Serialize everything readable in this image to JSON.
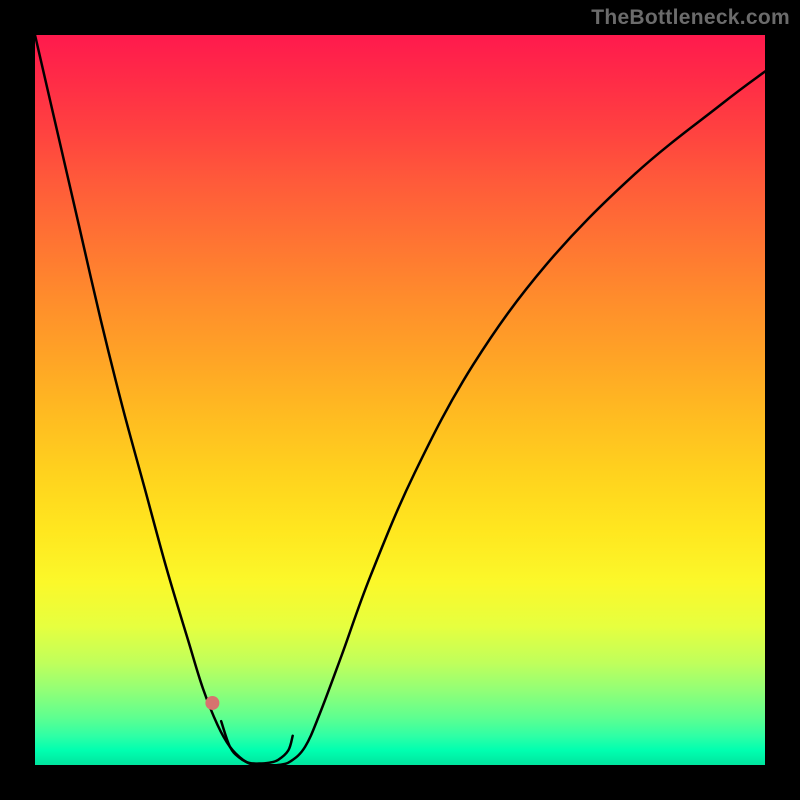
{
  "watermark": "TheBottleneck.com",
  "chart_data": {
    "type": "line",
    "title": "",
    "xlabel": "",
    "ylabel": "",
    "xlim": [
      0,
      1
    ],
    "ylim": [
      0,
      1
    ],
    "series": [
      {
        "name": "bottleneck-curve",
        "x": [
          0.0,
          0.03,
          0.06,
          0.09,
          0.12,
          0.15,
          0.18,
          0.21,
          0.23,
          0.25,
          0.267,
          0.285,
          0.3,
          0.316,
          0.333,
          0.35,
          0.37,
          0.39,
          0.42,
          0.46,
          0.52,
          0.6,
          0.7,
          0.82,
          0.94,
          1.0
        ],
        "y": [
          1.0,
          0.87,
          0.74,
          0.61,
          0.49,
          0.38,
          0.27,
          0.17,
          0.105,
          0.055,
          0.025,
          0.007,
          0.0,
          0.0,
          0.0,
          0.005,
          0.025,
          0.07,
          0.15,
          0.26,
          0.4,
          0.548,
          0.685,
          0.808,
          0.905,
          0.95
        ]
      }
    ],
    "markers": {
      "name": "highlight-region",
      "color": "#d6736f",
      "points_x": [
        0.255,
        0.267,
        0.28,
        0.293,
        0.307,
        0.32,
        0.333,
        0.347,
        0.353
      ],
      "points_y": [
        0.06,
        0.025,
        0.01,
        0.003,
        0.002,
        0.003,
        0.007,
        0.02,
        0.04
      ],
      "extra_dot": {
        "x": 0.243,
        "y": 0.085
      }
    },
    "background": {
      "type": "vertical-gradient",
      "stops": [
        {
          "pos": 0.0,
          "color": "#ff1a4d"
        },
        {
          "pos": 0.5,
          "color": "#ffd21e"
        },
        {
          "pos": 0.9,
          "color": "#8fff78"
        },
        {
          "pos": 1.0,
          "color": "#00e49e"
        }
      ]
    }
  }
}
